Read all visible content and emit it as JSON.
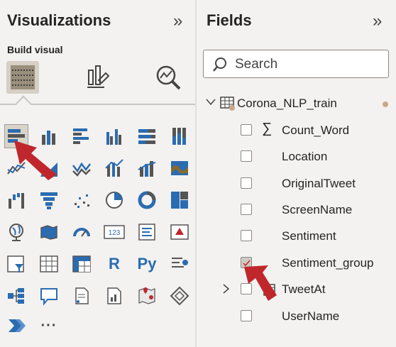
{
  "visualizations": {
    "title": "Visualizations",
    "collapse": "»",
    "build_visual": "Build visual",
    "more": "···"
  },
  "fields": {
    "title": "Fields",
    "collapse": "»",
    "search_placeholder": "Search",
    "table_name": "Corona_NLP_train",
    "items": [
      {
        "label": "Count_Word",
        "checked": false,
        "sigma": true
      },
      {
        "label": "Location",
        "checked": false
      },
      {
        "label": "OriginalTweet",
        "checked": false
      },
      {
        "label": "ScreenName",
        "checked": false
      },
      {
        "label": "Sentiment",
        "checked": false
      },
      {
        "label": "Sentiment_group",
        "checked": true
      },
      {
        "label": "TweetAt",
        "checked": false,
        "expandable": true
      },
      {
        "label": "UserName",
        "checked": false
      }
    ],
    "sigma": "∑"
  },
  "colors": {
    "accent_red": "#c0272d",
    "bar_blue": "#2b6cb0"
  },
  "grid_text": {
    "r_visual": "R",
    "py_visual": "Py",
    "card_visual": "123"
  }
}
